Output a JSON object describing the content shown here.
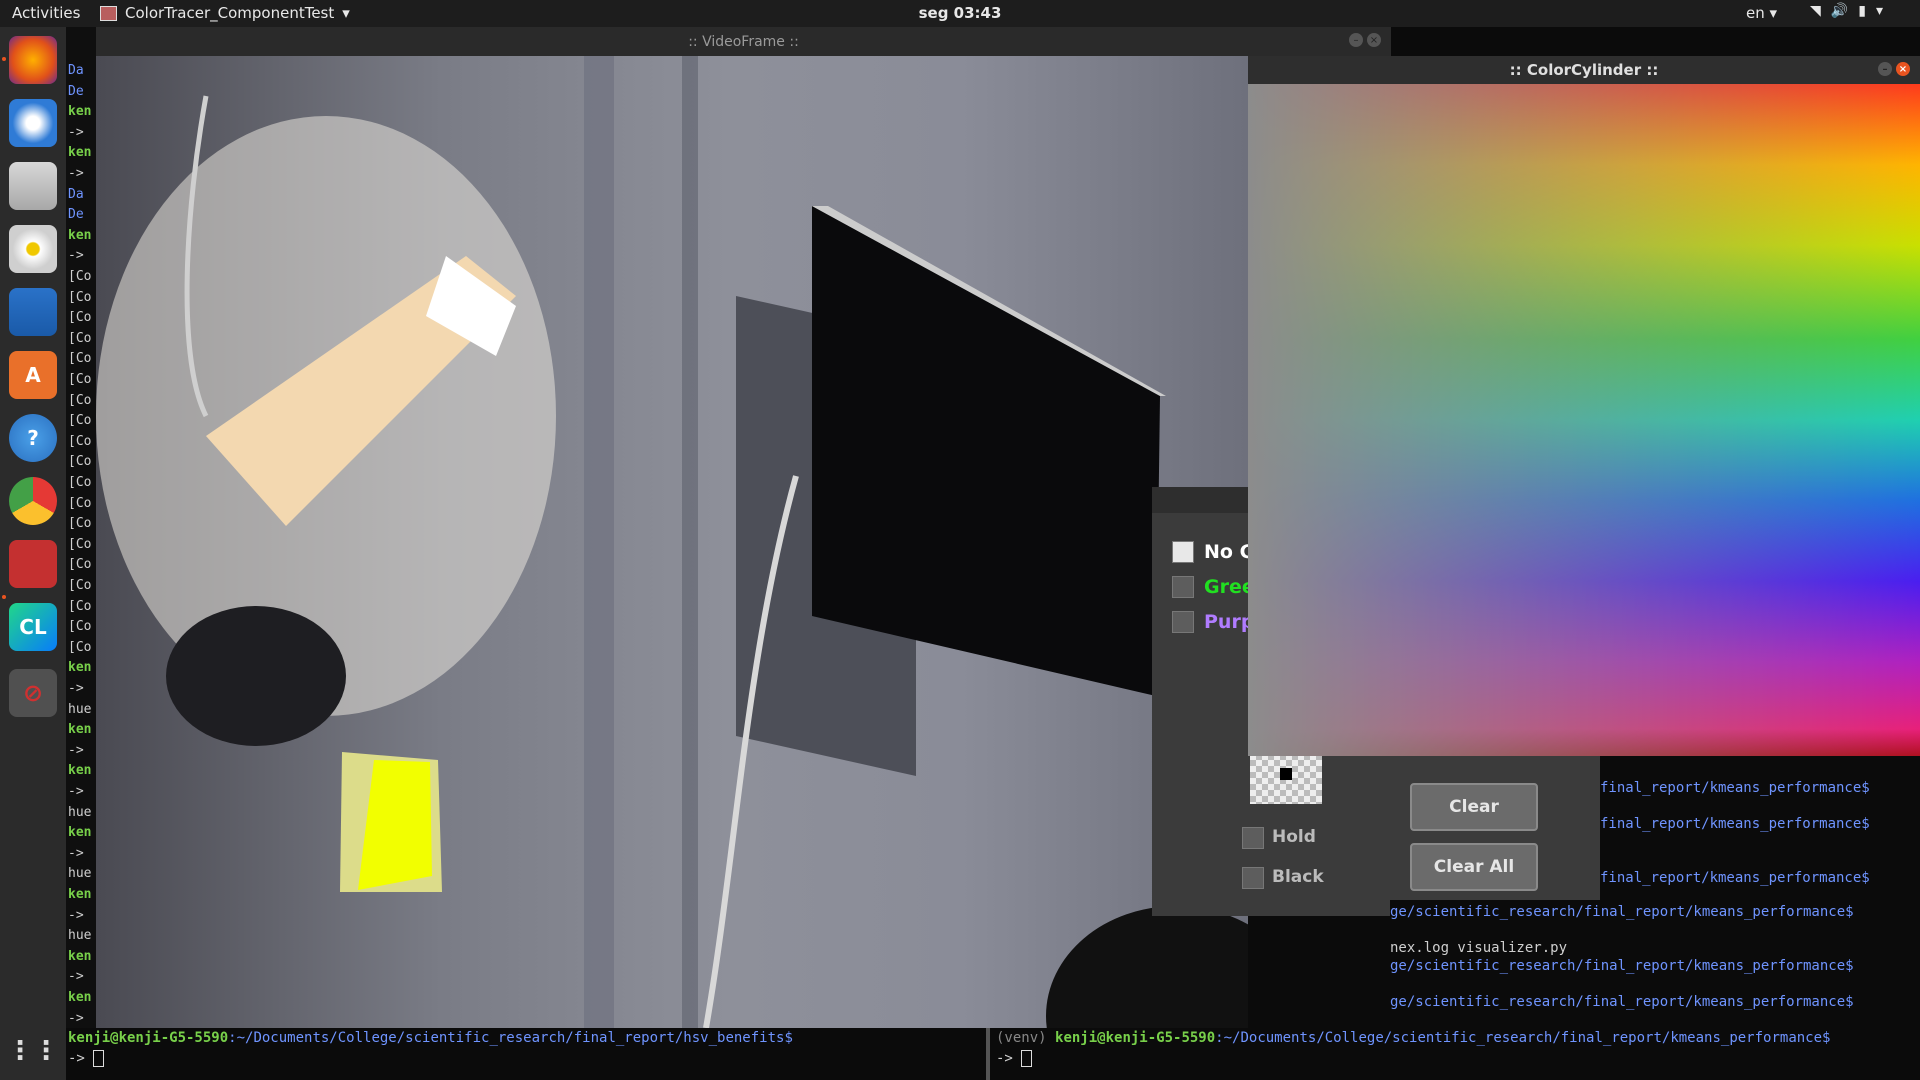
{
  "topbar": {
    "activities": "Activities",
    "app_name": "ColorTracer_ComponentTest",
    "clock": "seg 03:43",
    "lang": "en"
  },
  "dock": {
    "items": [
      "firefox-icon",
      "thunderbird-icon",
      "files-icon",
      "rhythmbox-icon",
      "writer-icon",
      "software-icon",
      "help-icon",
      "chrome-icon",
      "video-app-icon",
      "clion-icon",
      "active-app-icon"
    ],
    "apps_grid": "show-apps-icon"
  },
  "videoframe": {
    "title": ":: VideoFrame ::"
  },
  "colorcylinder": {
    "title": ":: ColorCylinder ::"
  },
  "panel": {
    "check1": "No C",
    "check2": "Gree",
    "check3": "Purp",
    "hold": "Hold",
    "black": "Black",
    "clear": "Clear",
    "clear_all": "Clear All",
    "colors": {
      "green": "#21e021",
      "purple": "#b07cff"
    }
  },
  "left_terminal": {
    "lines": [
      "Da",
      "De",
      "ken",
      "->",
      "ken",
      "->",
      "Da",
      "De",
      "ken",
      "->",
      "[Co",
      "[Co",
      "[Co",
      "[Co",
      "[Co",
      "[Co",
      "[Co",
      "[Co",
      "[Co",
      "[Co",
      "[Co",
      "[Co",
      "[Co",
      "[Co",
      "[Co",
      "[Co",
      "[Co",
      "[Co",
      "[Co",
      "ken",
      "->",
      "hue",
      "ken",
      "->",
      "ken",
      "->",
      "hue",
      "ken",
      "->",
      "hue",
      "ken",
      "->",
      "hue",
      "ken",
      "->",
      "ken",
      "->",
      "hue"
    ]
  },
  "bottom_left_terminal": {
    "user": "kenji@kenji-G5-5590",
    "path": ":~/Documents/College/scientific_research/final_report/hsv_benefits$",
    "prompt": "->"
  },
  "bottom_right_terminal": {
    "venv": "(venv) ",
    "user": "kenji@kenji-G5-5590",
    "path": ":~/Documents/College/scientific_research/final_report/kmeans_performance$",
    "prompt": "->"
  },
  "right_terminal": {
    "line1": "final_report/kmeans_performance$",
    "line2": "final_report/kmeans_performance$",
    "line3": "final_report/kmeans_performance$",
    "line4": "ge/scientific_research/final_report/kmeans_performance$",
    "files": "nex.log  visualizer.py",
    "line5": "ge/scientific_research/final_report/kmeans_performance$",
    "line6": "ge/scientific_research/final_report/kmeans_performance$"
  }
}
